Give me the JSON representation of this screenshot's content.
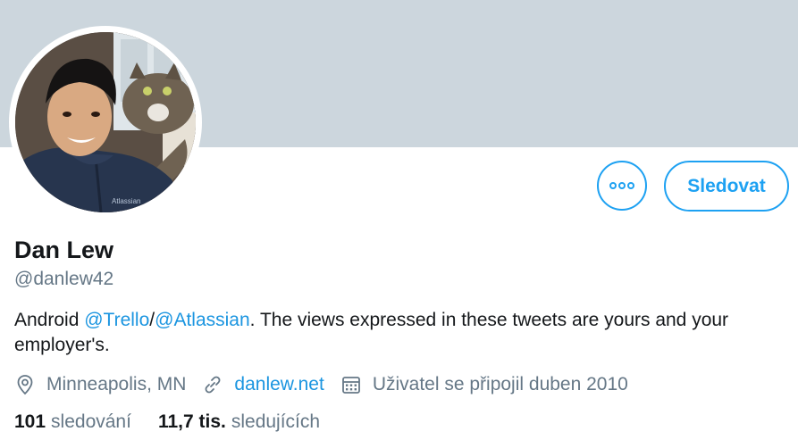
{
  "colors": {
    "banner": "#ccd6dd",
    "accent": "#1da1f2",
    "link": "#1b95e0",
    "text": "#14171a",
    "muted": "#657786"
  },
  "profile": {
    "name": "Dan Lew",
    "handle": "@danlew42",
    "bio": {
      "prefix": "Android ",
      "mention1": "@Trello",
      "separator": "/",
      "mention2": "@Atlassian",
      "suffix": ". The views expressed in these tweets are yours and your employer's."
    },
    "location": "Minneapolis, MN",
    "website": "danlew.net",
    "joined": "Uživatel se připojil duben 2010",
    "following_count": "101",
    "following_label": "sledování",
    "followers_count": "11,7 tis.",
    "followers_label": "sledujících"
  },
  "actions": {
    "more_icon": "more-horizontal-icon",
    "follow_label": "Sledovat"
  },
  "icons": {
    "location": "location-pin-icon",
    "website": "link-icon",
    "joined": "calendar-icon"
  }
}
